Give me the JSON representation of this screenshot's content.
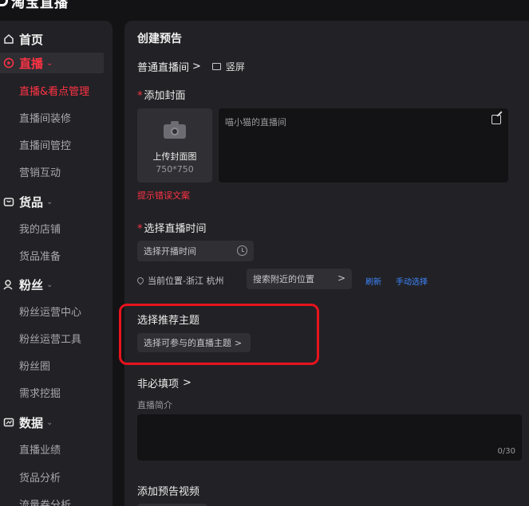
{
  "brand": {
    "name": "淘宝直播"
  },
  "sidebar": {
    "sections": [
      {
        "label": "首页",
        "icon": "home-icon"
      },
      {
        "label": "直播",
        "icon": "live-icon",
        "active": true
      },
      {
        "label": "货品",
        "icon": "goods-icon"
      },
      {
        "label": "粉丝",
        "icon": "fans-icon"
      },
      {
        "label": "数据",
        "icon": "data-icon"
      }
    ],
    "items": [
      {
        "label": "直播&看点管理",
        "active": true
      },
      {
        "label": "直播间装修"
      },
      {
        "label": "直播间管控"
      },
      {
        "label": "营销互动"
      },
      {
        "label": "我的店铺"
      },
      {
        "label": "货品准备"
      },
      {
        "label": "粉丝运营中心"
      },
      {
        "label": "粉丝运营工具"
      },
      {
        "label": "粉丝圈"
      },
      {
        "label": "需求挖掘"
      },
      {
        "label": "直播业绩"
      },
      {
        "label": "货品分析"
      },
      {
        "label": "流量券分析"
      }
    ]
  },
  "main": {
    "page_title": "创建预告",
    "live_type": "普通直播间",
    "live_type_chevron": ">",
    "orientation": "竖屏",
    "cover": {
      "required_mark": "*",
      "label": "添加封面",
      "upload_label": "上传封面图",
      "upload_size": "750*750",
      "title_placeholder": "喵小猫的直播间",
      "error_hint": "提示错误文案"
    },
    "time": {
      "required_mark": "*",
      "label": "选择直播时间",
      "placeholder": "选择开播时间"
    },
    "location": {
      "current": "当前位置-浙江 杭州",
      "search_placeholder": "搜索附近的位置",
      "search_chevron": ">",
      "refresh": "刷新",
      "manual": "手动选择"
    },
    "topic": {
      "label": "选择推荐主题",
      "select_label": "选择可参与的直播主题",
      "select_chevron": ">"
    },
    "optional": {
      "label": "非必填项",
      "chevron": ">",
      "intro_label": "直播简介",
      "intro_counter": "0/30"
    },
    "video": {
      "label": "添加预告视频"
    }
  },
  "colors": {
    "accent": "#ff3344",
    "highlight": "#e8131d",
    "link": "#3d86ff",
    "panel": "#222226",
    "background": "#131315"
  }
}
